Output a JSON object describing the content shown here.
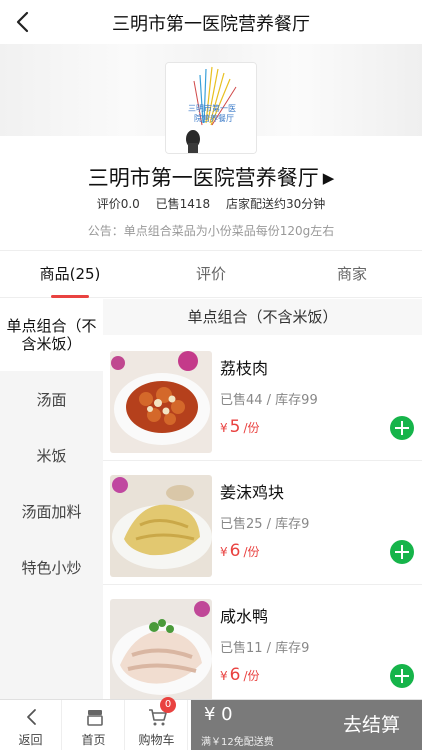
{
  "nav": {
    "title": "三明市第一医院营养餐厅"
  },
  "shop": {
    "name": "三明市第一医院营养餐厅",
    "rating": "评价0.0",
    "sold": "已售1418",
    "delivery": "店家配送约30分钟",
    "notice": "公告：单点组合菜品为小份菜品每份120g左右",
    "logo_text_1": "三明市第一医",
    "logo_text_2": "院营养餐厅"
  },
  "tabs": [
    {
      "label": "商品(25)"
    },
    {
      "label": "评价"
    },
    {
      "label": "商家"
    }
  ],
  "categories": [
    {
      "label": "单点组合（不含米饭）"
    },
    {
      "label": "汤面"
    },
    {
      "label": "米饭"
    },
    {
      "label": "汤面加料"
    },
    {
      "label": "特色小炒"
    }
  ],
  "menu": {
    "section_title": "单点组合（不含米饭）",
    "dishes": [
      {
        "name": "荔枝肉",
        "stats": "已售44 / 库存99",
        "currency": "¥",
        "price": "5",
        "unit": "/份"
      },
      {
        "name": "姜沫鸡块",
        "stats": "已售25 / 库存9",
        "currency": "¥",
        "price": "6",
        "unit": "/份"
      },
      {
        "name": "咸水鸭",
        "stats": "已售11 / 库存9",
        "currency": "¥",
        "price": "6",
        "unit": "/份"
      }
    ]
  },
  "bottom": {
    "back_label": "返回",
    "home_label": "首页",
    "cart_label": "购物车",
    "cart_count": "0",
    "total": "¥ 0",
    "delivery_note": "满￥12免配送费",
    "checkout_label": "去结算"
  },
  "colors": {
    "accent": "#e94240",
    "add_green": "#16b44a",
    "checkout_gray": "#7a7a7a"
  }
}
